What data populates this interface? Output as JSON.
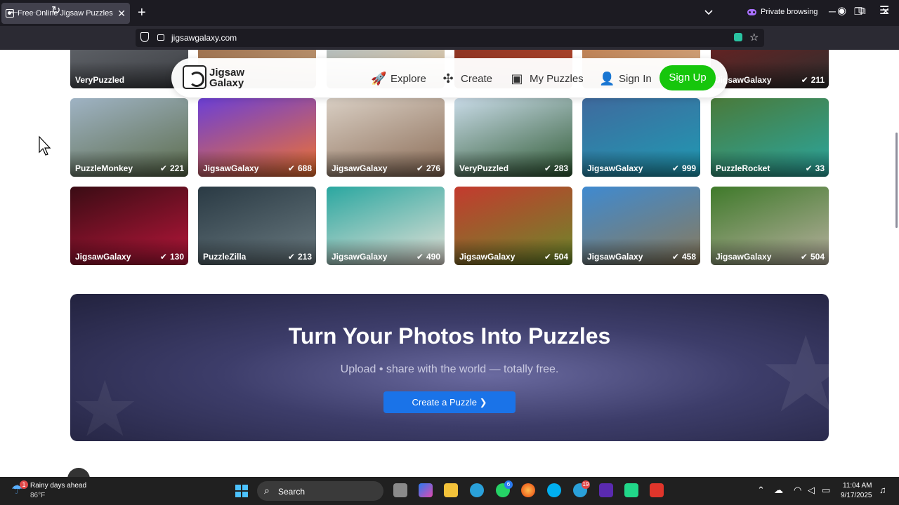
{
  "browser": {
    "tab_title": "Free Online Jigsaw Puzzles for A",
    "url": "jigsawgalaxy.com",
    "private_label": "Private browsing"
  },
  "site_nav": {
    "logo_line1": "Jigsaw",
    "logo_line2": "Galaxy",
    "explore": "Explore",
    "create": "Create",
    "my_puzzles": "My Puzzles",
    "sign_in": "Sign In",
    "sign_up": "Sign Up"
  },
  "rows": [
    [
      {
        "author": "VeryPuzzled",
        "count": "",
        "colors": [
          "#6b6f75",
          "#3d3f44"
        ]
      },
      {
        "author": "",
        "count": "",
        "colors": [
          "#8a5a3a",
          "#c7a27c"
        ]
      },
      {
        "author": "",
        "count": "",
        "colors": [
          "#9ab7c9",
          "#e8c8a0"
        ]
      },
      {
        "author": "",
        "count": "",
        "colors": [
          "#7a2a1e",
          "#b84a2e"
        ]
      },
      {
        "author": "",
        "count": "",
        "colors": [
          "#b06a3a",
          "#d8b08a"
        ]
      },
      {
        "author": "JigsawGalaxy",
        "count": "211",
        "colors": [
          "#7a1d1d",
          "#2f2f2f"
        ]
      }
    ],
    [
      {
        "author": "PuzzleMonkey",
        "count": "221",
        "colors": [
          "#9fb3c4",
          "#5b6b4a"
        ]
      },
      {
        "author": "JigsawGalaxy",
        "count": "688",
        "colors": [
          "#6b3fd6",
          "#f2732e"
        ]
      },
      {
        "author": "JigsawGalaxy",
        "count": "276",
        "colors": [
          "#d9cfc4",
          "#8a6b55"
        ]
      },
      {
        "author": "VeryPuzzled",
        "count": "283",
        "colors": [
          "#c9dbe8",
          "#2f5a34"
        ]
      },
      {
        "author": "JigsawGalaxy",
        "count": "999",
        "colors": [
          "#3f6a9e",
          "#1f9bb3"
        ]
      },
      {
        "author": "PuzzleRocket",
        "count": "33",
        "colors": [
          "#4a7a3a",
          "#2aa7a0"
        ]
      }
    ],
    [
      {
        "author": "JigsawGalaxy",
        "count": "130",
        "colors": [
          "#3a0c14",
          "#b8163a"
        ]
      },
      {
        "author": "PuzzleZilla",
        "count": "213",
        "colors": [
          "#2a3a44",
          "#6a7a80"
        ]
      },
      {
        "author": "JigsawGalaxy",
        "count": "490",
        "colors": [
          "#2aa7a0",
          "#e8e2d8"
        ]
      },
      {
        "author": "JigsawGalaxy",
        "count": "504",
        "colors": [
          "#c43a2e",
          "#6a8a2a"
        ]
      },
      {
        "author": "JigsawGalaxy",
        "count": "458",
        "colors": [
          "#3f8ad0",
          "#8a7a5a"
        ]
      },
      {
        "author": "JigsawGalaxy",
        "count": "504",
        "colors": [
          "#3f7a2a",
          "#b8b0a0"
        ]
      }
    ]
  ],
  "hero": {
    "title": "Turn Your Photos Into Puzzles",
    "subtitle": "Upload • share with the world — totally free.",
    "button": "Create a Puzzle"
  },
  "taskbar": {
    "weather_line1": "Rainy days ahead",
    "weather_line2": "86°F",
    "weather_badge": "1",
    "search_label": "Search",
    "whatsapp_badge": "6",
    "telegram_badge": "19",
    "time": "11:04 AM",
    "date": "9/17/2025"
  }
}
